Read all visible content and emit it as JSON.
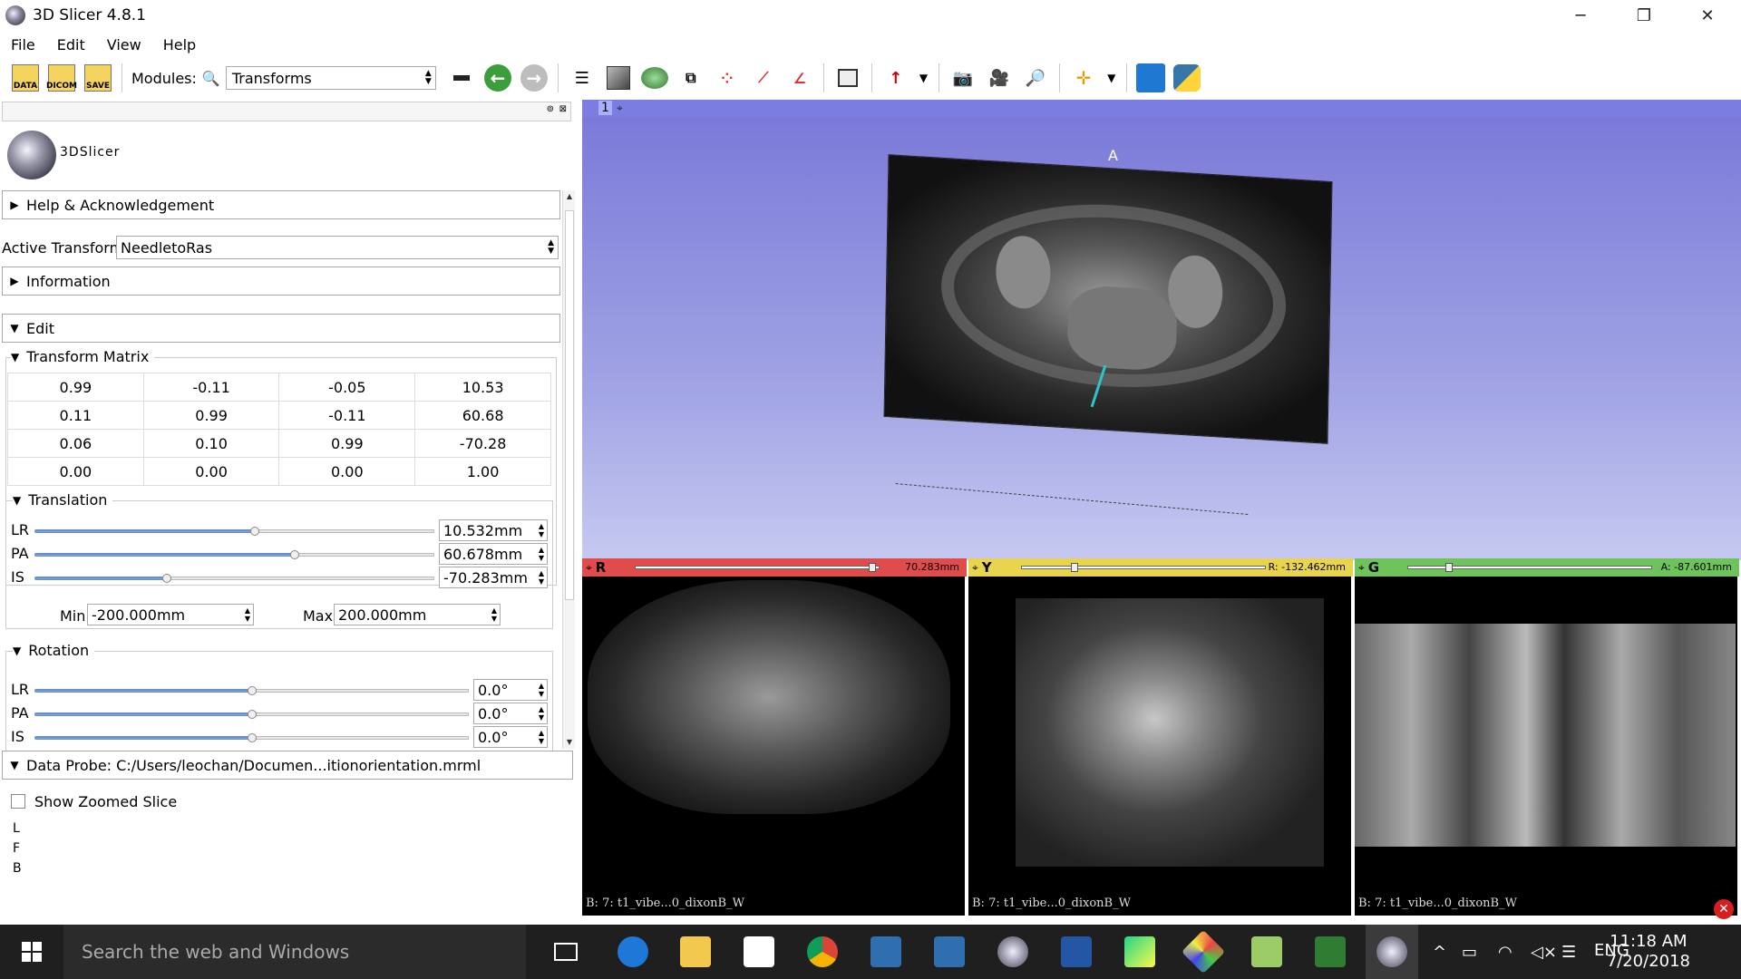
{
  "window": {
    "title": "3D Slicer 4.8.1",
    "minimize": "─",
    "maximize": "❐",
    "close": "✕"
  },
  "menu": [
    "File",
    "Edit",
    "View",
    "Help"
  ],
  "toolbar": {
    "data_label": "DATA",
    "dicom_label": "DICOM",
    "save_label": "SAVE",
    "modules_label": "Modules:",
    "module_selected": "Transforms"
  },
  "panel": {
    "logo_text": "3DSlicer",
    "help_section": "Help & Acknowledgement",
    "active_transform_label": "Active Transform:",
    "active_transform_value": "NeedletoRas",
    "information_section": "Information",
    "edit_section": "Edit",
    "transform_matrix_title": "Transform Matrix",
    "matrix": [
      [
        "0.99",
        "-0.11",
        "-0.05",
        "10.53"
      ],
      [
        "0.11",
        "0.99",
        "-0.11",
        "60.68"
      ],
      [
        "0.06",
        "0.10",
        "0.99",
        "-70.28"
      ],
      [
        "0.00",
        "0.00",
        "0.00",
        "1.00"
      ]
    ],
    "translation_title": "Translation",
    "translation": [
      {
        "label": "LR",
        "value": "10.532mm",
        "fraction": 0.55
      },
      {
        "label": "PA",
        "value": "60.678mm",
        "fraction": 0.65
      },
      {
        "label": "IS",
        "value": "-70.283mm",
        "fraction": 0.33
      }
    ],
    "min_label": "Min",
    "min_value": "-200.000mm",
    "max_label": "Max",
    "max_value": "200.000mm",
    "rotation_title": "Rotation",
    "rotation": [
      {
        "label": "LR",
        "value": "0.0°",
        "fraction": 0.5
      },
      {
        "label": "PA",
        "value": "0.0°",
        "fraction": 0.5
      },
      {
        "label": "IS",
        "value": "0.0°",
        "fraction": 0.5
      }
    ],
    "data_probe": "Data Probe: C:/Users/leochan/Documen...itionorientation.mrml",
    "show_zoomed_slice": "Show Zoomed Slice",
    "probe_letters": [
      "L",
      "F",
      "B"
    ]
  },
  "viewer": {
    "view3d_number": "1",
    "orientation_label": "A",
    "slices": [
      {
        "name": "red",
        "letter": "R",
        "color": "#e04c4c",
        "value": "70.283mm",
        "volume": "B: 7: t1_vibe...0_dixonB_W",
        "fraction": 0.95
      },
      {
        "name": "yellow",
        "letter": "Y",
        "color": "#e8d44d",
        "value": "R: -132.462mm",
        "volume": "B: 7: t1_vibe...0_dixonB_W",
        "fraction": 0.2
      },
      {
        "name": "green",
        "letter": "G",
        "color": "#6ec35a",
        "value": "A: -87.601mm",
        "volume": "B: 7: t1_vibe...0_dixonB_W",
        "fraction": 0.15
      }
    ]
  },
  "taskbar": {
    "search_placeholder": "Search the web and Windows",
    "language": "ENG",
    "time": "11:18 AM",
    "date": "7/20/2018"
  },
  "colors": {
    "view3d_top": "#7b7ad9",
    "view3d_bottom": "#c6c9f0",
    "needle": "#2cc6c6",
    "taskbar": "#1f1f1f"
  }
}
